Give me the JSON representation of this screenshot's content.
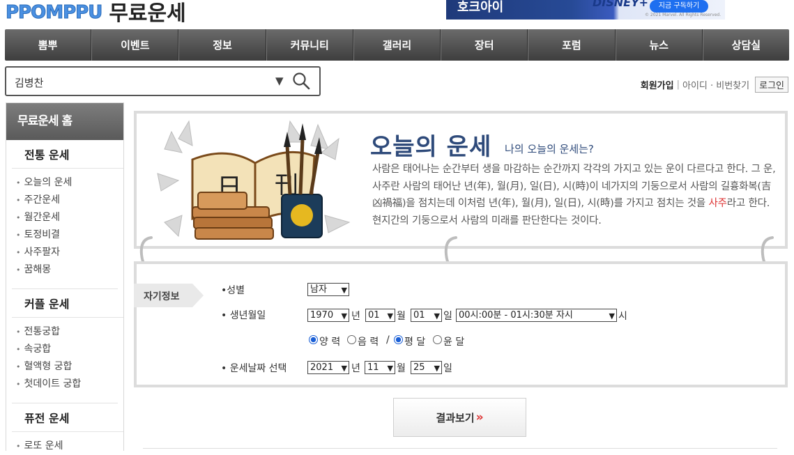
{
  "header": {
    "logo_brand": "PPOMPPU",
    "site_title": "무료운세",
    "ad_text": "호크아이",
    "ad_brand": "DISNEY+",
    "ad_button": "지금 구독하기",
    "ad_copyright": "© 2021 Marvel. All Rights Reserved."
  },
  "nav": [
    "뽐뿌",
    "이벤트",
    "정보",
    "커뮤니티",
    "갤러리",
    "장터",
    "포럼",
    "뉴스",
    "상담실"
  ],
  "search": {
    "value": "김병찬"
  },
  "auth": {
    "join": "회원가입",
    "sep": "|",
    "find": "아이디 · 비번찾기",
    "login": "로그인"
  },
  "sidebar": {
    "home": "무료운세 홈",
    "sections": [
      {
        "title": "전통 운세",
        "items": [
          "오늘의 운세",
          "주간운세",
          "월간운세",
          "토정비결",
          "사주팔자",
          "꿈해몽"
        ]
      },
      {
        "title": "커플 운세",
        "items": [
          "전통궁합",
          "속궁합",
          "혈액형 궁합",
          "첫데이트 궁합"
        ]
      },
      {
        "title": "퓨전 운세",
        "items": [
          "로또 운세"
        ]
      }
    ]
  },
  "intro": {
    "art_chars": [
      "日",
      "刊"
    ],
    "title": "오늘의 운세",
    "subtitle": "나의 오늘의 운세는?",
    "desc_1": "사람은 태어나는 순간부터 생을 마감하는 순간까지 각각의 가지고 있는 운이 다르다고 한다. 그 운, 사주란 사람의 태어난 년(年), 월(月), 일(日), 시(時)이 네가지의 기둥으로서 사람의 길흉화복(吉凶禍福)을 점치는데 이처럼 년(年), 월(月), 일(日), 시(時)를 가지고 점치는 것을 ",
    "desc_red": "사주",
    "desc_2": "라고 한다. 현지간의 기둥으로서 사람의 미래를 판단한다는 것이다."
  },
  "form": {
    "tag": "자기정보",
    "gender_label": "•성별",
    "gender_value": "남자",
    "birth_label": "• 생년월일",
    "birth_year": "1970",
    "birth_month": "01",
    "birth_day": "01",
    "birth_time": "00시:00분 - 01시:30분 자시",
    "unit_year": "년",
    "unit_month": "월",
    "unit_day": "일",
    "unit_hour": "시",
    "cal_solar": "양 력",
    "cal_lunar": "음 력",
    "cal_sep": "/",
    "leap_normal": "평 달",
    "leap_leap": "윤 달",
    "fortune_label": "• 운세날짜 선택",
    "fortune_year": "2021",
    "fortune_month": "11",
    "fortune_day": "25"
  },
  "result_button": "결과보기",
  "result_button_suffix": "»"
}
